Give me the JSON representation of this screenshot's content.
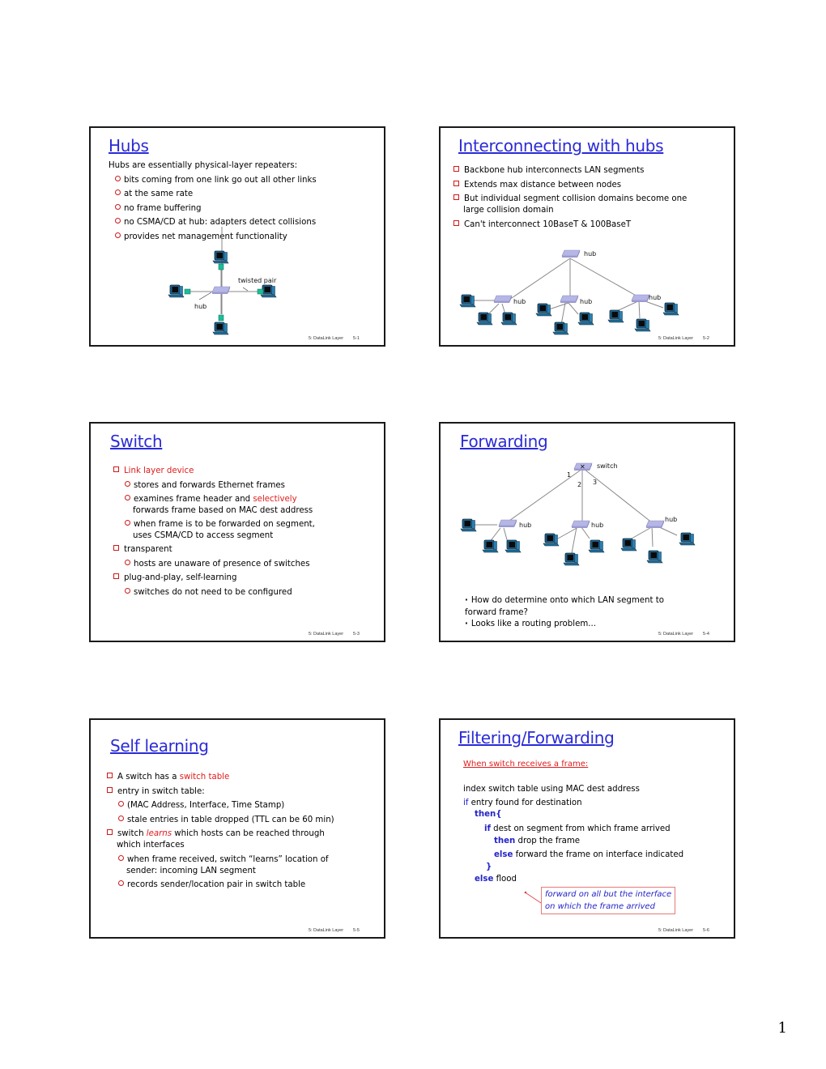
{
  "page_number": "1",
  "footer_label": "5: DataLink Layer",
  "slides": [
    {
      "title": "Hubs",
      "intro": "Hubs are essentially physical-layer repeaters:",
      "bullets": [
        "bits coming from one link go out all other links",
        "at the same rate",
        "no frame buffering",
        "no CSMA/CD at hub: adapters detect collisions",
        "provides net management functionality"
      ],
      "diagram": {
        "hub_label": "hub",
        "cable_label": "twisted pair"
      },
      "slide_number": "5-1"
    },
    {
      "title": "Interconnecting with hubs",
      "bullets": [
        "Backbone hub interconnects LAN segments",
        "Extends max distance between nodes",
        "But individual segment collision domains become one",
        "large collision domain",
        "Can't interconnect 10BaseT & 100BaseT"
      ],
      "diagram": {
        "backbone_label": "hub",
        "hub_labels": [
          "hub",
          "hub",
          "hub"
        ]
      },
      "slide_number": "5-2"
    },
    {
      "title": "Switch",
      "items": [
        {
          "level": 1,
          "text": "Link layer device",
          "style": "red"
        },
        {
          "level": 2,
          "text": "stores and forwards Ethernet frames"
        },
        {
          "level": 2,
          "text_before": "examines frame header and ",
          "highlight": "selectively",
          "text_after": ""
        },
        {
          "level": 2,
          "continuation": true,
          "text": "forwards  frame based on MAC dest address"
        },
        {
          "level": 2,
          "text": "when frame is to be forwarded on segment,"
        },
        {
          "level": 2,
          "continuation": true,
          "text": "uses CSMA/CD to access segment"
        },
        {
          "level": 1,
          "text": "transparent"
        },
        {
          "level": 2,
          "text": "hosts are unaware of presence of switches"
        },
        {
          "level": 1,
          "text": "plug-and-play, self-learning"
        },
        {
          "level": 2,
          "text": "switches do not need to be configured"
        }
      ],
      "slide_number": "5-3"
    },
    {
      "title": "Forwarding",
      "diagram": {
        "switch_label": "switch",
        "port_labels": [
          "1",
          "2",
          "3"
        ],
        "hub_labels": [
          "hub",
          "hub",
          "hub"
        ]
      },
      "notes": [
        "How do determine onto which LAN segment to",
        "forward frame?",
        "Looks like a routing problem..."
      ],
      "slide_number": "5-4"
    },
    {
      "title": "Self learning",
      "items": [
        {
          "level": 1,
          "text_before": "A switch has a ",
          "highlight": "switch table"
        },
        {
          "level": 1,
          "text": "entry in switch table:"
        },
        {
          "level": 2,
          "text": "(MAC Address, Interface, Time Stamp)"
        },
        {
          "level": 2,
          "text": "stale entries in table dropped (TTL can be 60 min)"
        },
        {
          "level": 1,
          "text_before": "switch ",
          "highlight": "learns",
          "text_after": " which hosts can be reached through"
        },
        {
          "level": 1,
          "continuation": true,
          "text": "which interfaces"
        },
        {
          "level": 2,
          "text": "when frame received, switch “learns”  location of"
        },
        {
          "level": 2,
          "continuation": true,
          "text": "sender: incoming LAN segment"
        },
        {
          "level": 2,
          "text": "records sender/location pair in switch table"
        }
      ],
      "slide_number": "5-5"
    },
    {
      "title": "Filtering/Forwarding",
      "subtitle": "When switch receives a frame:",
      "code": {
        "line1": "index switch table using MAC dest address",
        "if_kw": "if",
        "line2": " entry found for destination",
        "then_kw": "then{",
        "if2_kw": "if",
        "line3": " dest on segment from which frame arrived",
        "then2_kw": "then",
        "line4": " drop the frame",
        "else_kw": "else",
        "line5": " forward the frame on interface indicated",
        "close": "}",
        "else2_kw": "else",
        "line6": " flood"
      },
      "note": [
        "forward on all but the interface",
        "on which the frame arrived"
      ],
      "slide_number": "5-6"
    }
  ]
}
